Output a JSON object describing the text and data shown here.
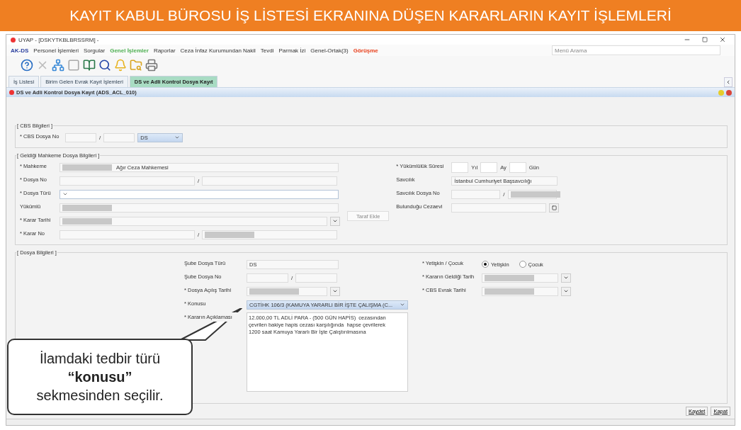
{
  "banner": {
    "title": "KAYIT KABUL BÜROSU İŞ LİSTESİ EKRANINA DÜŞEN KARARLARIN KAYIT İŞLEMLERİ"
  },
  "window": {
    "title": "UYAP - [DSKYTKBLBRSSRM] -"
  },
  "menu": [
    {
      "label": "AK-DS",
      "kind": "brand"
    },
    {
      "label": "Personel İşlemleri",
      "kind": "normal"
    },
    {
      "label": "Sorgular",
      "kind": "normal"
    },
    {
      "label": "Genel İşlemler",
      "kind": "highlight"
    },
    {
      "label": "Raporlar",
      "kind": "normal"
    },
    {
      "label": "Ceza İnfaz Kurumundan Nakil",
      "kind": "normal"
    },
    {
      "label": "Tevdi",
      "kind": "normal"
    },
    {
      "label": "Parmak İzi",
      "kind": "normal"
    },
    {
      "label": "Genel-Ortak(3)",
      "kind": "normal"
    },
    {
      "label": "Görüşme",
      "kind": "alert"
    }
  ],
  "search": {
    "placeholder": "Menü Arama"
  },
  "tabs": [
    {
      "label": "İş Listesi",
      "selected": false
    },
    {
      "label": "Birim Gelen Evrak Kayıt İşlemleri",
      "selected": false
    },
    {
      "label": "DS ve Adli Kontrol Dosya Kayıt",
      "selected": true
    }
  ],
  "form": {
    "title": "DS ve Adli Kontrol Dosya Kayıt (ADS_ACL_010)"
  },
  "cbs_section": {
    "legend": "[ CBS Bilgileri ]",
    "label": "* CBS Dosya No",
    "separator": "/",
    "type_value": "DS"
  },
  "court_section": {
    "legend": "[ Geldiği Mahkeme Dosya Bilgileri ]",
    "left": [
      {
        "kind": "text",
        "label": "* Mahkeme",
        "value": "Ağır Ceza Mahkemesi",
        "redacted": true
      },
      {
        "kind": "split",
        "label": "* Dosya No",
        "separator": "/",
        "redacted": false
      },
      {
        "kind": "select",
        "label": "* Dosya Türü",
        "redacted": false
      },
      {
        "kind": "text",
        "label": "Yükümlü",
        "redacted": true
      },
      {
        "kind": "date",
        "label": "* Karar Tarihi",
        "redacted": true
      },
      {
        "kind": "split",
        "label": "* Karar No",
        "separator": "/",
        "redacted": true
      }
    ],
    "button": "Taraf Ekle",
    "right": [
      {
        "kind": "duration",
        "label": "* Yükümlülük Süresi",
        "units": [
          "Yıl",
          "Ay",
          "Gün"
        ]
      },
      {
        "kind": "text",
        "label": "Savcılık",
        "value": "İstanbul Cumhuriyet Başsavcılığı",
        "redacted": false
      },
      {
        "kind": "split",
        "label": "Savcılık Dosya No",
        "separator": "/",
        "redacted": true
      },
      {
        "kind": "lookup",
        "label": "Bulunduğu Cezaevi",
        "redacted": false
      }
    ]
  },
  "file_section": {
    "legend": "[ Dosya Bilgileri ]",
    "left": [
      {
        "kind": "text",
        "label": "Şube Dosya Türü",
        "value": "DS",
        "redacted": false
      },
      {
        "kind": "split",
        "label": "Şube Dosya No",
        "separator": "/",
        "redacted": false
      },
      {
        "kind": "date",
        "label": "* Dosya Açılış Tarihi",
        "redacted": true
      },
      {
        "kind": "select",
        "label": "* Konusu",
        "value": "CGTİHK 106/3 (KAMUYA YARARLI BİR İŞTE ÇALIŞMA (C...",
        "redacted": false
      },
      {
        "kind": "textarea",
        "label": "* Kararın Açıklaması",
        "value": "12.000,00 TL ADLİ PARA - (500 GÜN HAPİS)  cezasından\nçevrilen bakiye hapis cezası karşılığında  hapse çevrilerek\n1200 saat Kamuya Yararlı Bir İşte Çalıştırılmasına"
      }
    ],
    "right": [
      {
        "kind": "radio",
        "label": "* Yetişkin / Çocuk",
        "options": [
          {
            "label": "Yetişkin",
            "selected": true
          },
          {
            "label": "Çocuk",
            "selected": false
          }
        ]
      },
      {
        "kind": "date",
        "label": "* Kararın Geldiği Tarih",
        "redacted": true
      },
      {
        "kind": "date",
        "label": "* CBS Evrak Tarihi",
        "redacted": true
      }
    ]
  },
  "buttons": [
    "Kaydet",
    "Kapat"
  ],
  "callout": {
    "lines": [
      "İlamdaki tedbir türü",
      "**“konusu”**",
      "sekmesinden seçilir."
    ]
  }
}
